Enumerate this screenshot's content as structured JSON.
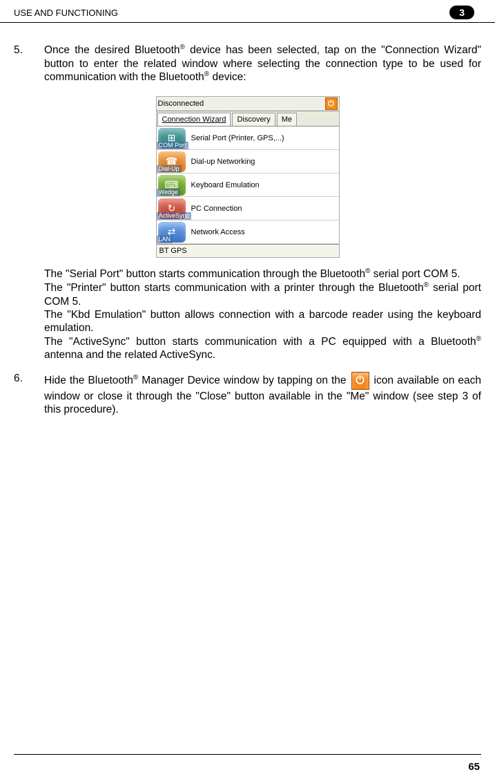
{
  "header": {
    "title": "USE AND FUNCTIONING",
    "badge": "3"
  },
  "step5": {
    "num": "5.",
    "text_before": "Once the desired Bluetooth",
    "text_after": " device has been selected, tap on the \"Connection Wizard\" button to enter the related window where selecting the connection type to be used for communication with the Bluetooth",
    "text_tail": " device:"
  },
  "screenshot": {
    "status": "Disconnected",
    "tabs": [
      "Connection Wizard",
      "Discovery",
      "Me"
    ],
    "rows": [
      {
        "side": "COM Port",
        "label": "Serial Port (Printer, GPS,...)",
        "iconClass": "ic-teal",
        "glyph": "⊞"
      },
      {
        "side": "Dial-Up",
        "label": "Dial-up Networking",
        "iconClass": "ic-orange",
        "glyph": "☎"
      },
      {
        "side": "Wedge",
        "label": "Keyboard Emulation",
        "iconClass": "ic-green",
        "glyph": "⌨"
      },
      {
        "side": "ActiveSync",
        "label": "PC Connection",
        "iconClass": "ic-red",
        "glyph": "↻"
      },
      {
        "side": "LAN",
        "label": "Network Access",
        "iconClass": "ic-blue",
        "glyph": "⇄"
      }
    ],
    "footer": "BT GPS"
  },
  "paras": {
    "p1a": "The \"Serial Port\" button starts communication through the Bluetooth",
    "p1b": " serial port COM 5.",
    "p2a": "The \"Printer\" button starts communication with a printer through the Bluetooth",
    "p2b": " serial port COM 5.",
    "p3": "The \"Kbd Emulation\" button allows connection with a barcode reader using the keyboard emulation.",
    "p4a": "The \"ActiveSync\" button starts communication with a PC equipped with a Bluetooth",
    "p4b": " antenna and the related ActiveSync."
  },
  "step6": {
    "num": "6.",
    "a": "Hide the Bluetooth",
    "b": " Manager Device window by tapping on the ",
    "c": " icon available on each window or close it through the \"Close\" button available in the \"Me\" window (see step 3 of this procedure)."
  },
  "reg": "®",
  "powerGlyph": "⏻",
  "pageNumber": "65"
}
